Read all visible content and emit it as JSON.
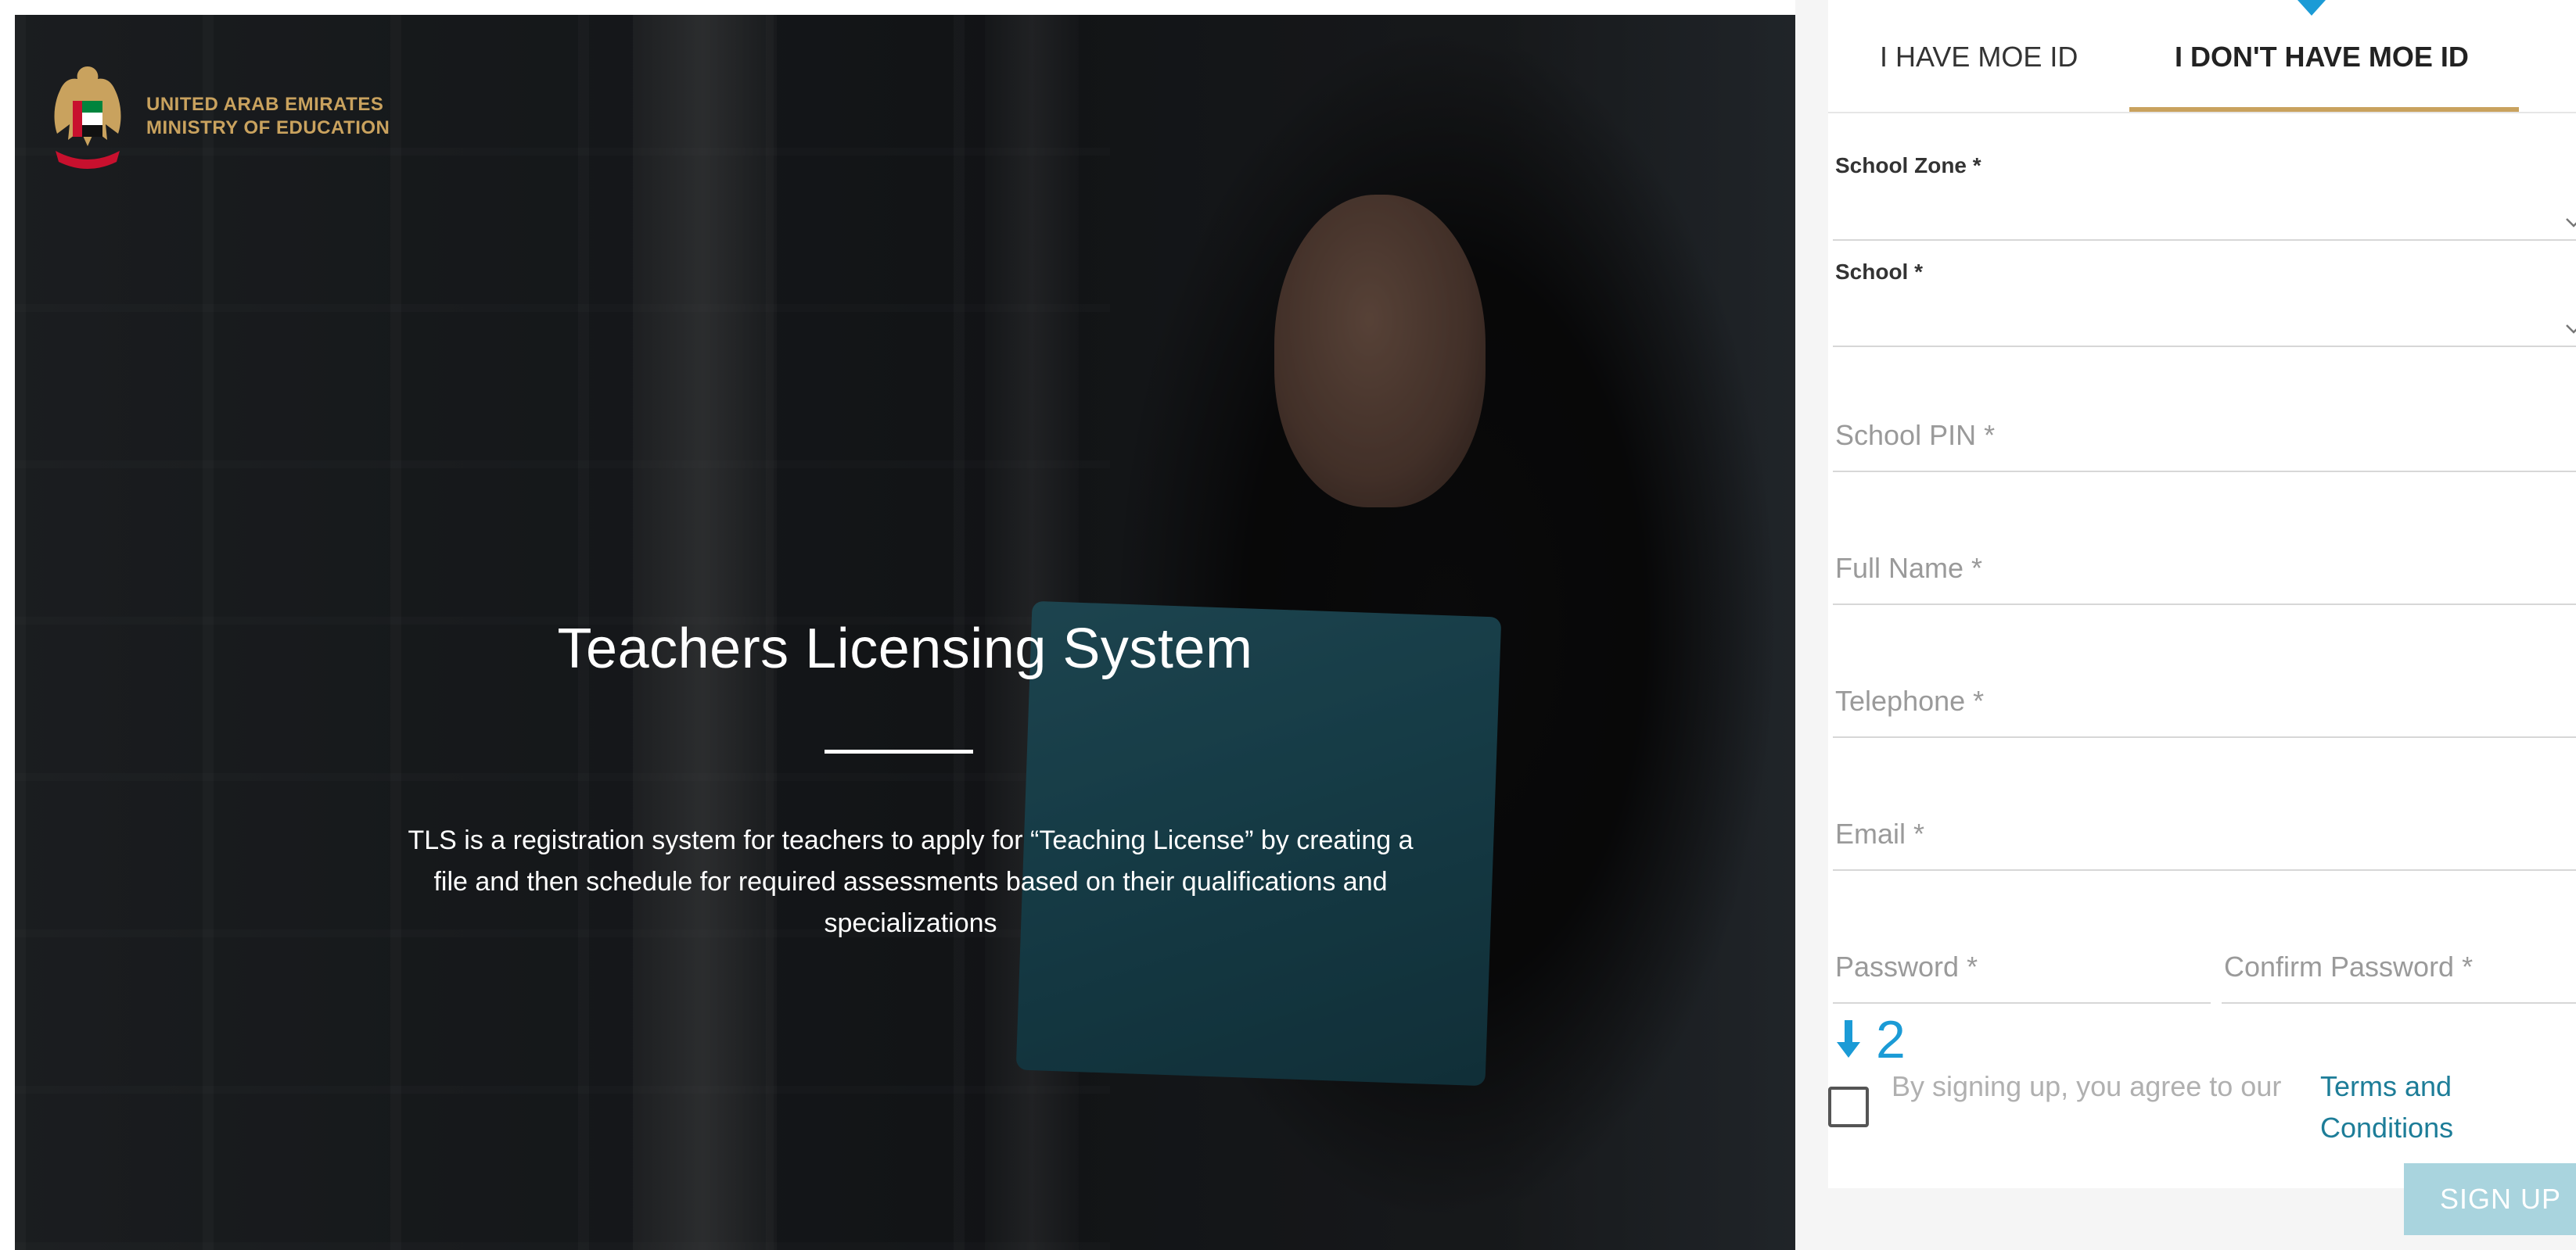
{
  "branding": {
    "line1": "UNITED ARAB EMIRATES",
    "line2": "MINISTRY OF EDUCATION",
    "emblem_icon": "uae-falcon-emblem-icon",
    "gold": "#c9a25e"
  },
  "hero": {
    "title": "Teachers Licensing System",
    "description": "TLS is a registration system for teachers to apply for “Teaching License” by creating a file and then schedule for required assessments based on their qualifications and specializations"
  },
  "tabs": [
    {
      "label": "I HAVE MOE ID",
      "active": false
    },
    {
      "label": "I DON'T HAVE MOE ID",
      "active": true
    }
  ],
  "form": {
    "school_zone": {
      "label": "School Zone *",
      "value": ""
    },
    "school": {
      "label": "School *",
      "value": ""
    },
    "school_pin": {
      "label": "School PIN *",
      "value": ""
    },
    "full_name": {
      "label": "Full Name *",
      "value": ""
    },
    "telephone": {
      "label": "Telephone *",
      "value": ""
    },
    "email": {
      "label": "Email *",
      "value": ""
    },
    "password": {
      "label": "Password *",
      "value": ""
    },
    "confirm_password": {
      "label": "Confirm Password *",
      "value": ""
    },
    "agree_text": "By signing up, you agree to our",
    "terms_link": "Terms and Conditions",
    "agree_checked": false,
    "signup_label": "SIGN UP"
  },
  "annotations": {
    "step_number": "2",
    "marker_color": "#1b9bd6"
  },
  "colors": {
    "accent_gold": "#c9a25e",
    "link_teal": "#1d7d98",
    "button_disabled": "#a9d4de"
  }
}
